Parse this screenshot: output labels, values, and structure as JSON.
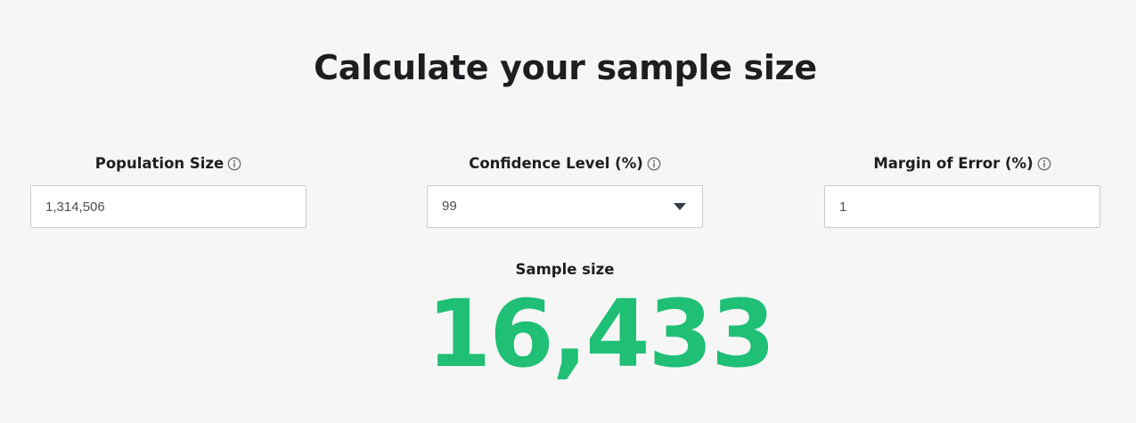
{
  "page": {
    "title": "Calculate your sample size"
  },
  "fields": {
    "population": {
      "label": "Population Size",
      "value": "1,314,506",
      "info_icon": "info-icon"
    },
    "confidence": {
      "label": "Confidence Level (%)",
      "value": "99",
      "info_icon": "info-icon",
      "control_icon": "caret-down-icon"
    },
    "margin": {
      "label": "Margin of Error (%)",
      "value": "1",
      "info_icon": "info-icon"
    }
  },
  "result": {
    "label": "Sample size",
    "value": "16,433"
  },
  "colors": {
    "background": "#f6f6f6",
    "text": "#1e1e21",
    "result": "#1fbf75",
    "input_border": "#c9cbce"
  }
}
